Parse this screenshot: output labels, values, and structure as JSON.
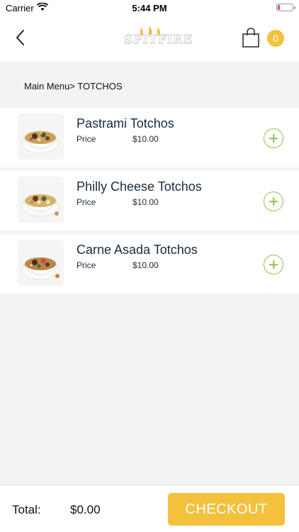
{
  "status_bar": {
    "carrier": "Carrier",
    "time": "5:44 PM"
  },
  "nav": {
    "logo_text": "SPITFIRE",
    "cart_count": "0"
  },
  "breadcrumb": "Main Menu> TOTCHOS",
  "items": [
    {
      "name": "Pastrami Totchos",
      "price_label": "Price",
      "price": "$10.00"
    },
    {
      "name": "Philly Cheese Totchos",
      "price_label": "Price",
      "price": "$10.00"
    },
    {
      "name": "Carne Asada Totchos",
      "price_label": "Price",
      "price": "$10.00"
    }
  ],
  "footer": {
    "total_label": "Total:",
    "total_value": "$0.00",
    "checkout_label": "CHECKOUT"
  },
  "colors": {
    "accent_yellow": "#f3c13c",
    "add_green": "#8cc34a",
    "text_dark": "#1a2b3c",
    "background": "#f3f3f3"
  },
  "icons": [
    "wifi-icon",
    "battery-icon",
    "back-chevron-icon",
    "shopping-bag-icon",
    "add-circle-icon"
  ]
}
